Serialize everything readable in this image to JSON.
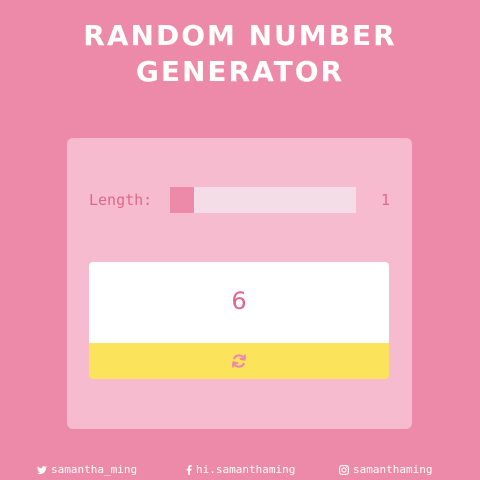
{
  "header": {
    "title_line1": "RANDOM NUMBER",
    "title_line2": "GENERATOR"
  },
  "generator": {
    "length_label": "Length:",
    "length_value": "1",
    "slider_level": 0,
    "output_number": "6",
    "refresh_icon": "refresh-icon"
  },
  "footer": {
    "twitter": {
      "icon": "twitter-icon",
      "label": "samantha_ming"
    },
    "facebook": {
      "icon": "facebook-icon",
      "label": "hi.samanthaming"
    },
    "instagram": {
      "icon": "instagram-icon",
      "label": "samanthaming"
    }
  },
  "colors": {
    "background": "#ee8aa9",
    "card": "#f6bbcf",
    "accent_text": "#e0668c",
    "slider_track": "#f4dde6",
    "slider_thumb": "#ee8aa9",
    "button": "#fce35c",
    "white": "#ffffff"
  }
}
